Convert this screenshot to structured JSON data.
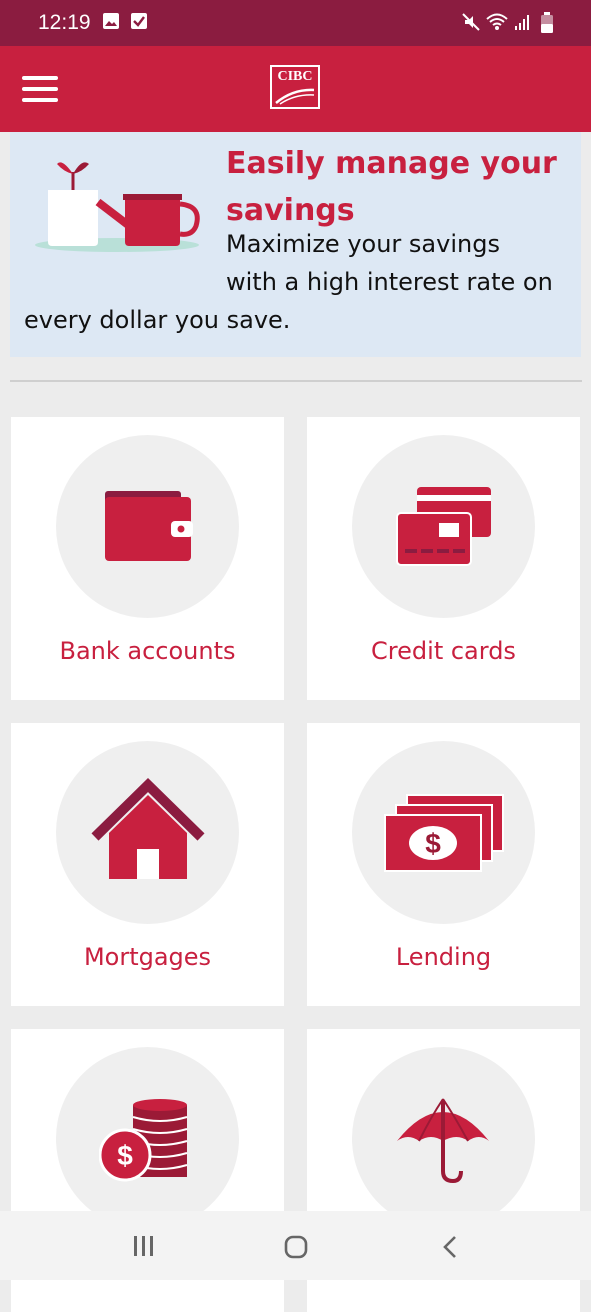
{
  "status_bar": {
    "time": "12:19",
    "left_icons": [
      "image-icon",
      "check-box-icon"
    ],
    "right_icons": [
      "mute-icon",
      "wifi-icon",
      "signal-icon",
      "battery-icon"
    ]
  },
  "app_bar": {
    "logo_text": "CIBC",
    "menu_icon": "hamburger-menu-icon"
  },
  "banner": {
    "title": "Easily manage your savings",
    "description_lines": [
      "Maximize your savings",
      "with a high interest rate on",
      "every dollar you save."
    ]
  },
  "tiles": [
    {
      "label": "Bank accounts",
      "icon": "wallet-icon"
    },
    {
      "label": "Credit cards",
      "icon": "credit-cards-icon"
    },
    {
      "label": "Mortgages",
      "icon": "house-icon"
    },
    {
      "label": "Lending",
      "icon": "cash-bills-icon"
    },
    {
      "label": "",
      "icon": "coins-icon"
    },
    {
      "label": "",
      "icon": "umbrella-icon"
    }
  ],
  "nav_bar": {
    "buttons": [
      "recent-apps-icon",
      "home-icon",
      "back-icon"
    ]
  },
  "colors": {
    "brand_red": "#c8203f",
    "status_bar": "#8b1c40",
    "dark_red": "#9b1a36",
    "banner_bg": "#dde8f4"
  }
}
